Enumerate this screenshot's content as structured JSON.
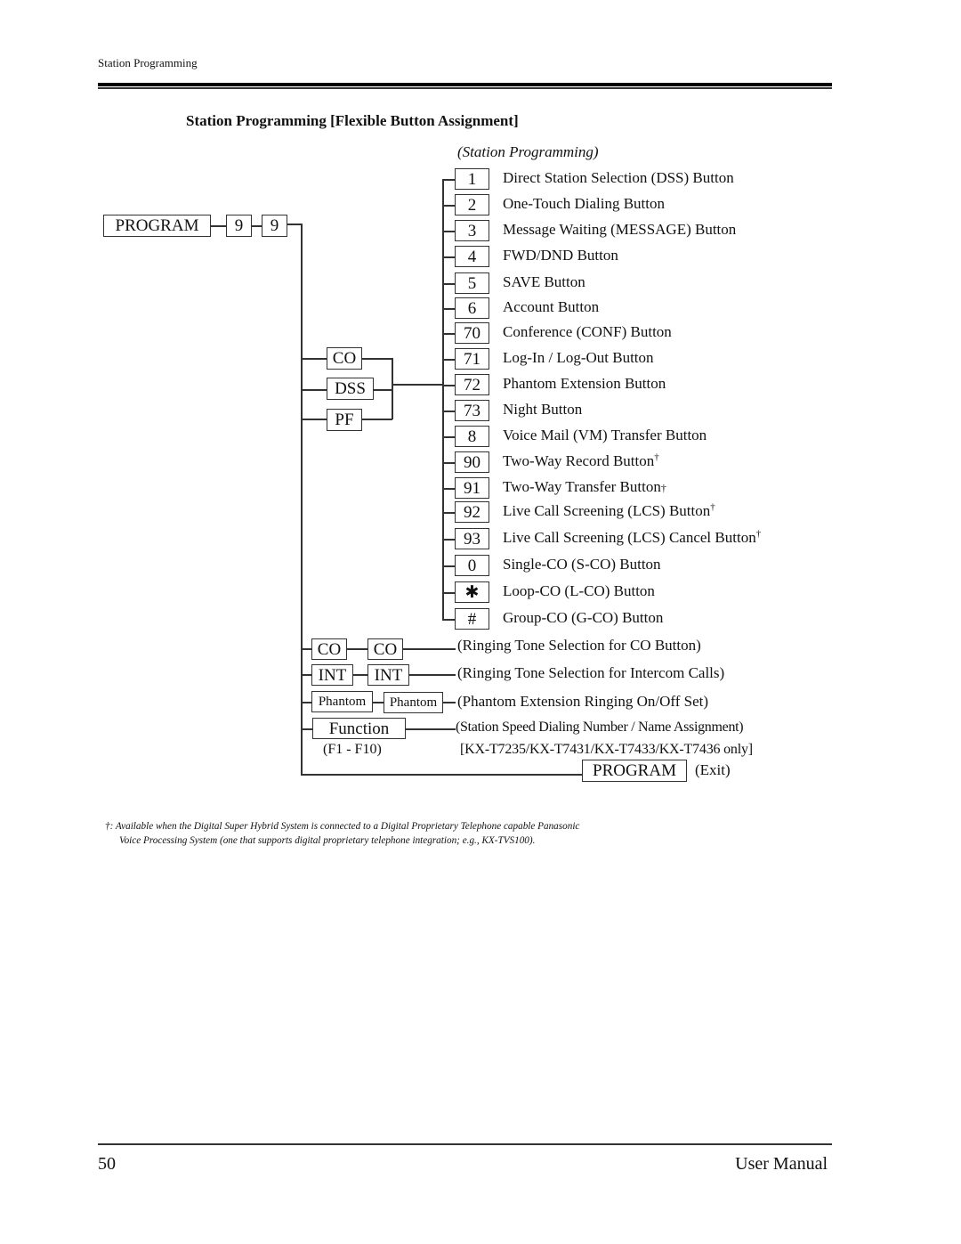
{
  "header": {
    "running_head": "Station Programming"
  },
  "section": {
    "title": "Station Programming [Flexible Button Assignment]",
    "mode_label": "(Station Programming)"
  },
  "entry_sequence": {
    "program_key": "PROGRAM",
    "digit_1": "9",
    "digit_2": "9"
  },
  "button_type_keys": [
    "CO",
    "DSS",
    "PF"
  ],
  "assignments": [
    {
      "code": "1",
      "label": "Direct Station Selection (DSS) Button",
      "dagger": ""
    },
    {
      "code": "2",
      "label": "One-Touch Dialing Button",
      "dagger": ""
    },
    {
      "code": "3",
      "label": "Message Waiting (MESSAGE) Button",
      "dagger": ""
    },
    {
      "code": "4",
      "label": "FWD/DND Button",
      "dagger": ""
    },
    {
      "code": "5",
      "label": "SAVE Button",
      "dagger": ""
    },
    {
      "code": "6",
      "label": "Account Button",
      "dagger": ""
    },
    {
      "code": "70",
      "label": "Conference (CONF) Button",
      "dagger": ""
    },
    {
      "code": "71",
      "label": "Log-In / Log-Out Button",
      "dagger": ""
    },
    {
      "code": "72",
      "label": "Phantom Extension Button",
      "dagger": ""
    },
    {
      "code": "73",
      "label": "Night Button",
      "dagger": ""
    },
    {
      "code": "8",
      "label": "Voice Mail (VM) Transfer Button",
      "dagger": ""
    },
    {
      "code": "90",
      "label": "Two-Way Record Button",
      "dagger": "†"
    },
    {
      "code": "91",
      "label": "Two-Way Transfer Button",
      "dagger": "†"
    },
    {
      "code": "92",
      "label": "Live Call Screening (LCS) Button",
      "dagger": "†"
    },
    {
      "code": "93",
      "label": "Live Call Screening (LCS) Cancel Button",
      "dagger": "†"
    },
    {
      "code": "0",
      "label": "Single-CO (S-CO) Button",
      "dagger": ""
    },
    {
      "code": "✱",
      "label": "Loop-CO (L-CO) Button",
      "dagger": ""
    },
    {
      "code": "#",
      "label": "Group-CO (G-CO) Button",
      "dagger": ""
    }
  ],
  "other_settings": [
    {
      "key1": "CO",
      "key2": "CO",
      "label": "(Ringing Tone Selection for CO Button)"
    },
    {
      "key1": "INT",
      "key2": "INT",
      "label": "(Ringing Tone Selection for Intercom Calls)"
    },
    {
      "key1": "Phantom",
      "key2": "Phantom",
      "label": "(Phantom Extension Ringing On/Off Set)"
    }
  ],
  "function_setting": {
    "key": "Function",
    "range": "(F1 - F10)",
    "label": "(Station Speed Dialing Number / Name Assignment)",
    "models": "[KX-T7235/KX-T7431/KX-T7433/KX-T7436 only]"
  },
  "exit": {
    "key": "PROGRAM",
    "label": "(Exit)"
  },
  "footnote": {
    "line1": "†: Available when the Digital Super Hybrid System is connected to a Digital Proprietary Telephone capable Panasonic",
    "line2": "Voice Processing System (one that supports digital proprietary telephone integration; e.g., KX-TVS100)."
  },
  "footer": {
    "page_number": "50",
    "title": "User Manual"
  }
}
